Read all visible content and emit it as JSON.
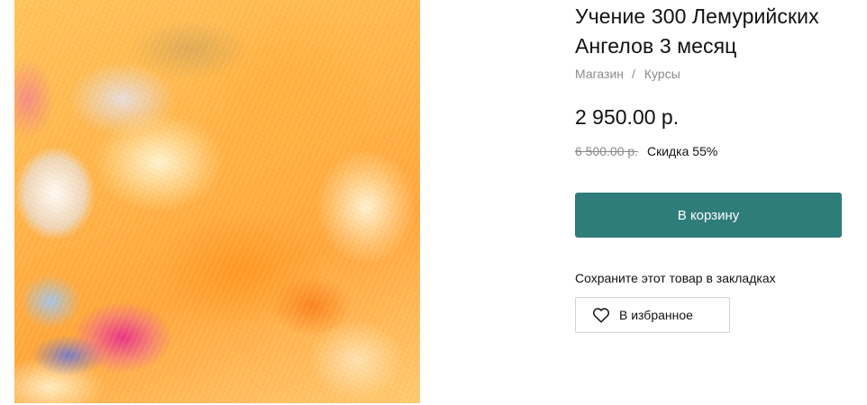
{
  "product": {
    "title": "Учение 300 Лемурийских Ангелов 3 месяц",
    "image_icon": "abstract-painting-image"
  },
  "breadcrumb": {
    "items": [
      "Магазин",
      "Курсы"
    ],
    "separator": "/"
  },
  "pricing": {
    "price": "2 950.00 р.",
    "old_price": "6 500.00 р.",
    "discount": "Скидка 55%"
  },
  "cart": {
    "button_label": "В корзину",
    "button_color": "#2f7d7a"
  },
  "bookmarks": {
    "prompt": "Сохраните этот товар в закладках",
    "favorite_label": "В избранное",
    "favorite_icon": "heart-icon"
  }
}
